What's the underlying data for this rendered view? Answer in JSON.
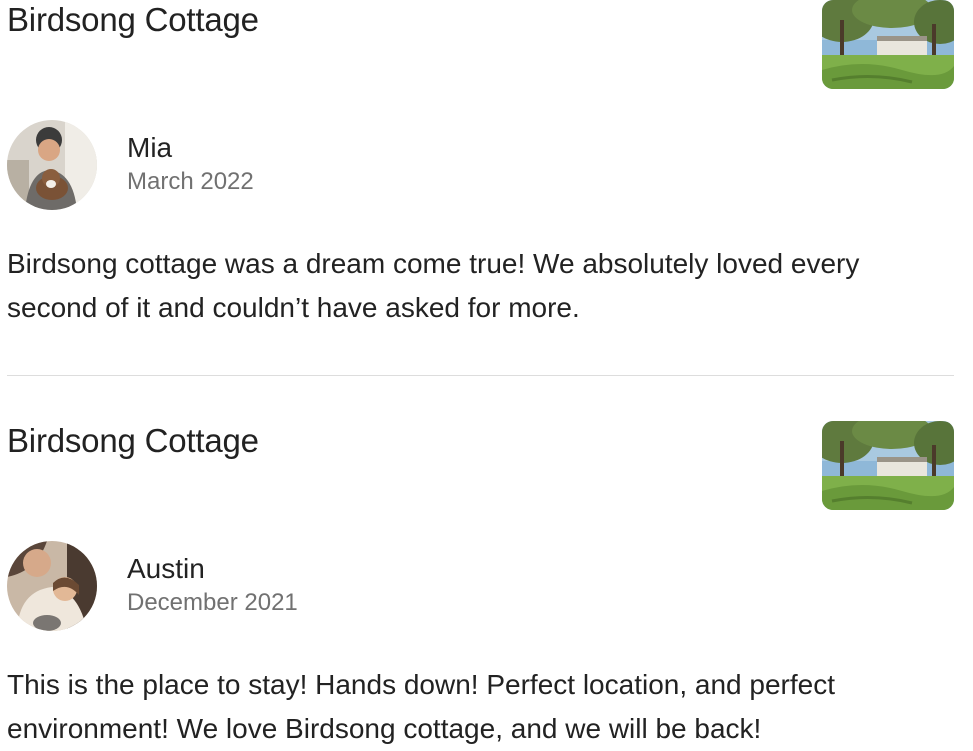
{
  "reviews": [
    {
      "listing_title": "Birdsong Cottage",
      "reviewer_name": "Mia",
      "date": "March 2022",
      "text": "Birdsong cottage was a dream come true! We absolutely loved every second of it and couldn’t have asked for more."
    },
    {
      "listing_title": "Birdsong Cottage",
      "reviewer_name": "Austin",
      "date": "December 2021",
      "text": "This is the place to stay! Hands down! Perfect location, and perfect environment! We love Birdsong cottage, and we will be back!"
    }
  ],
  "colors": {
    "text_primary": "#222222",
    "text_secondary": "#717171",
    "divider": "#dddddd"
  }
}
